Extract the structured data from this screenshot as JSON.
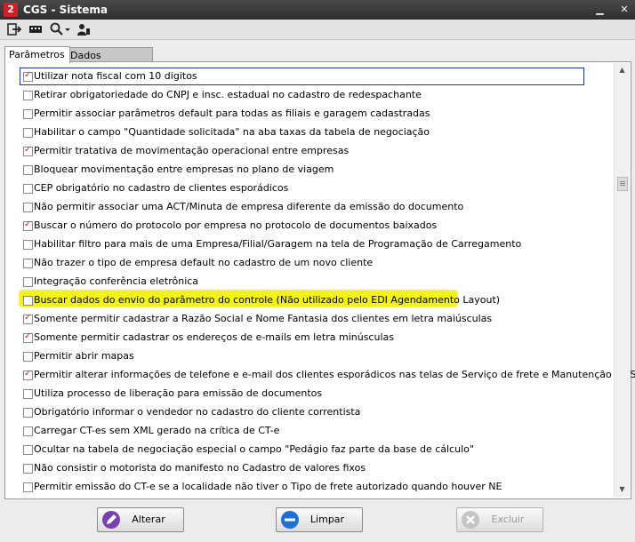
{
  "window": {
    "title": "CGS - Sistema",
    "app_icon_letter": "2"
  },
  "tabs": [
    {
      "label": "Parâmetros"
    },
    {
      "label": "Dados Adicionais"
    }
  ],
  "params": [
    {
      "label": "Utilizar nota fiscal com 10 digitos",
      "checked": true
    },
    {
      "label": "Retirar obrigatoriedade do CNPJ e insc. estadual no cadastro de redespachante",
      "checked": false
    },
    {
      "label": "Permitir associar parâmetros default para todas as filiais e garagem cadastradas",
      "checked": false
    },
    {
      "label": "Habilitar o campo \"Quantidade solicitada\" na aba taxas da tabela de negociação",
      "checked": false
    },
    {
      "label": "Permitir tratativa de movimentação operacional entre empresas",
      "checked": true
    },
    {
      "label": "Bloquear movimentação entre empresas no plano de viagem",
      "checked": false
    },
    {
      "label": "CEP obrigatório no cadastro de clientes esporádicos",
      "checked": false
    },
    {
      "label": "Não permitir associar uma ACT/Minuta de empresa diferente da emissão do documento",
      "checked": false
    },
    {
      "label": "Buscar o número do protocolo por empresa no protocolo de documentos baixados",
      "checked": true
    },
    {
      "label": "Habilitar filtro para mais de uma Empresa/Filial/Garagem na tela de Programação de Carregamento",
      "checked": false
    },
    {
      "label": "Não trazer o tipo de empresa default no cadastro de um novo cliente",
      "checked": false
    },
    {
      "label": "Integração conferência eletrônica",
      "checked": false
    },
    {
      "label": "Buscar dados do envio do parâmetro do controle (Não utilizado pelo EDI Agendamento Layout)",
      "checked": false
    },
    {
      "label": "Somente permitir cadastrar a Razão Social e Nome Fantasia dos clientes em letra maiúsculas",
      "checked": true
    },
    {
      "label": "Somente permitir cadastrar os endereços de e-mails em letra minúsculas",
      "checked": true
    },
    {
      "label": "Permitir abrir mapas",
      "checked": false
    },
    {
      "label": "Permitir alterar informações de telefone e e-mail dos clientes esporádicos nas telas de Serviço de frete e Manutenção de Serviço",
      "checked": true
    },
    {
      "label": "Utiliza processo de liberação para emissão de documentos",
      "checked": false
    },
    {
      "label": "Obrigatório informar o vendedor no cadastro do cliente correntista",
      "checked": false
    },
    {
      "label": "Carregar CT-es sem XML gerado na crítica de CT-e",
      "checked": false
    },
    {
      "label": "Ocultar na tabela de negociação especial o campo \"Pedágio faz parte da base de cálculo\"",
      "checked": false
    },
    {
      "label": "Não consistir o motorista do manifesto no Cadastro de valores fixos",
      "checked": false
    },
    {
      "label": "Permitir emissão do CT-e se a localidade não tiver o Tipo de frete autorizado quando houver NE",
      "checked": false
    }
  ],
  "buttons": {
    "alterar": "Alterar",
    "limpar": "Limpar",
    "excluir": "Excluir"
  },
  "colors": {
    "check": "#d42121",
    "highlight": "#f3f21a",
    "focus": "#1d33a8"
  }
}
